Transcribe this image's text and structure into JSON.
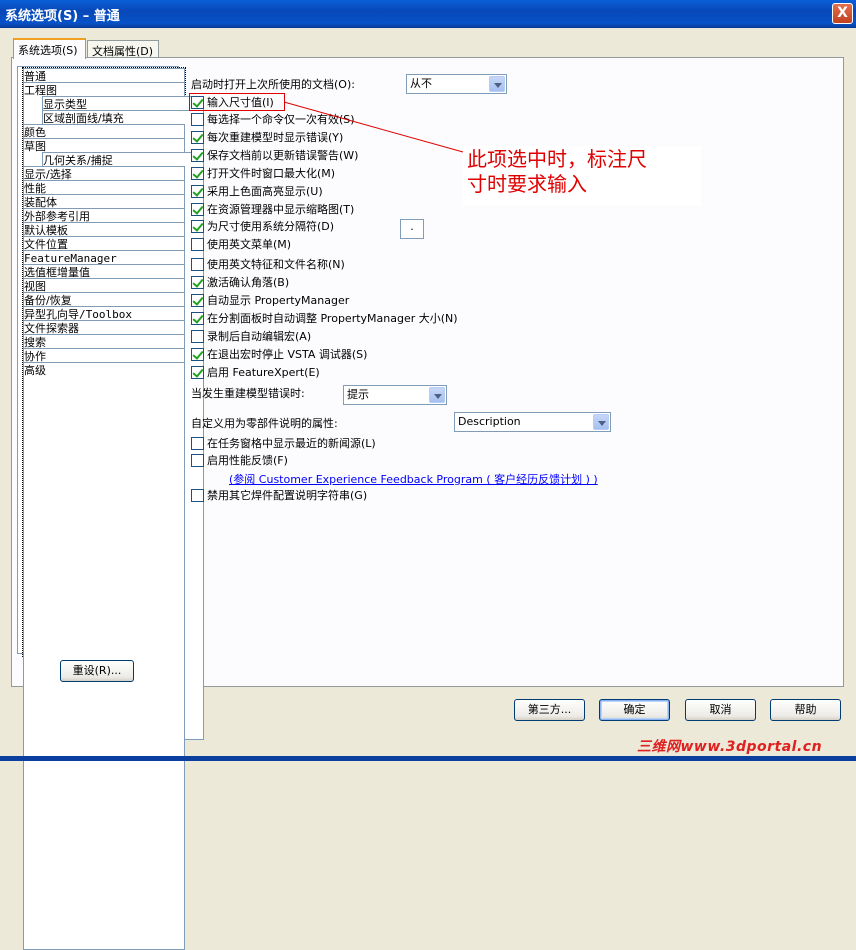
{
  "window": {
    "title": "系统选项(S) – 普通",
    "close_symbol": "X"
  },
  "tabs": [
    {
      "label": "系统选项(S)"
    },
    {
      "label": "文档属性(D)"
    }
  ],
  "tree": {
    "items": [
      "普通",
      "工程图",
      "显示类型",
      "区域剖面线/填充",
      "颜色",
      "草图",
      "几何关系/捕捉",
      "显示/选择",
      "性能",
      "装配体",
      "外部参考引用",
      "默认模板",
      "文件位置",
      "FeatureManager",
      "选值框增量值",
      "视图",
      "备份/恢复",
      "异型孔向导/Toolbox",
      "文件探索器",
      "搜索",
      "协作",
      "高级"
    ]
  },
  "reset_button": "重设(R)...",
  "main": {
    "open_last_doc_label": "启动时打开上次所使用的文档(O):",
    "open_last_doc_value": "从不",
    "checkboxes_a": [
      {
        "label": "输入尺寸值(I)",
        "checked": true
      },
      {
        "label": "每选择一个命令仅一次有效(S)",
        "checked": false
      },
      {
        "label": "每次重建模型时显示错误(Y)",
        "checked": true
      },
      {
        "label": "保存文档前以更新错误警告(W)",
        "checked": true
      },
      {
        "label": "打开文件时窗口最大化(M)",
        "checked": true
      },
      {
        "label": "采用上色面高亮显示(U)",
        "checked": true
      },
      {
        "label": "在资源管理器中显示缩略图(T)",
        "checked": true
      },
      {
        "label": "为尺寸使用系统分隔符(D)",
        "checked": true
      },
      {
        "label": "使用英文菜单(M)",
        "checked": false
      },
      {
        "label": "使用英文特征和文件名称(N)",
        "checked": false
      },
      {
        "label": "激活确认角落(B)",
        "checked": true
      },
      {
        "label": "自动显示 PropertyManager",
        "checked": true
      },
      {
        "label": "在分割面板时自动调整 PropertyManager 大小(N)",
        "checked": true
      },
      {
        "label": "录制后自动编辑宏(A)",
        "checked": false
      },
      {
        "label": "在退出宏时停止 VSTA 调试器(S)",
        "checked": true
      },
      {
        "label": "启用 FeatureXpert(E)",
        "checked": true
      }
    ],
    "separator_value": ".",
    "rebuild_error_label": "当发生重建模型错误时:",
    "rebuild_error_value": "提示",
    "part_desc_label": "自定义用为零部件说明的属性:",
    "part_desc_value": "Description",
    "checkboxes_b": [
      {
        "label": "在任务窗格中显示最近的新闻源(L)",
        "checked": false
      },
      {
        "label": "启用性能反馈(F)",
        "checked": false
      }
    ],
    "feedback_link": "(参阅 Customer Experience Feedback Program ( 客户经历反馈计划 ) )",
    "checkbox_c": {
      "label": "禁用其它焊件配置说明字符串(G)",
      "checked": false
    }
  },
  "annotation": {
    "line1": "此项选中时，标注尺",
    "line2": "寸时要求输入",
    "color": "#e00000"
  },
  "buttons": {
    "third_party": "第三方...",
    "ok": "确定",
    "cancel": "取消",
    "help": "帮助"
  },
  "watermark": "三维网www.3dportal.cn"
}
